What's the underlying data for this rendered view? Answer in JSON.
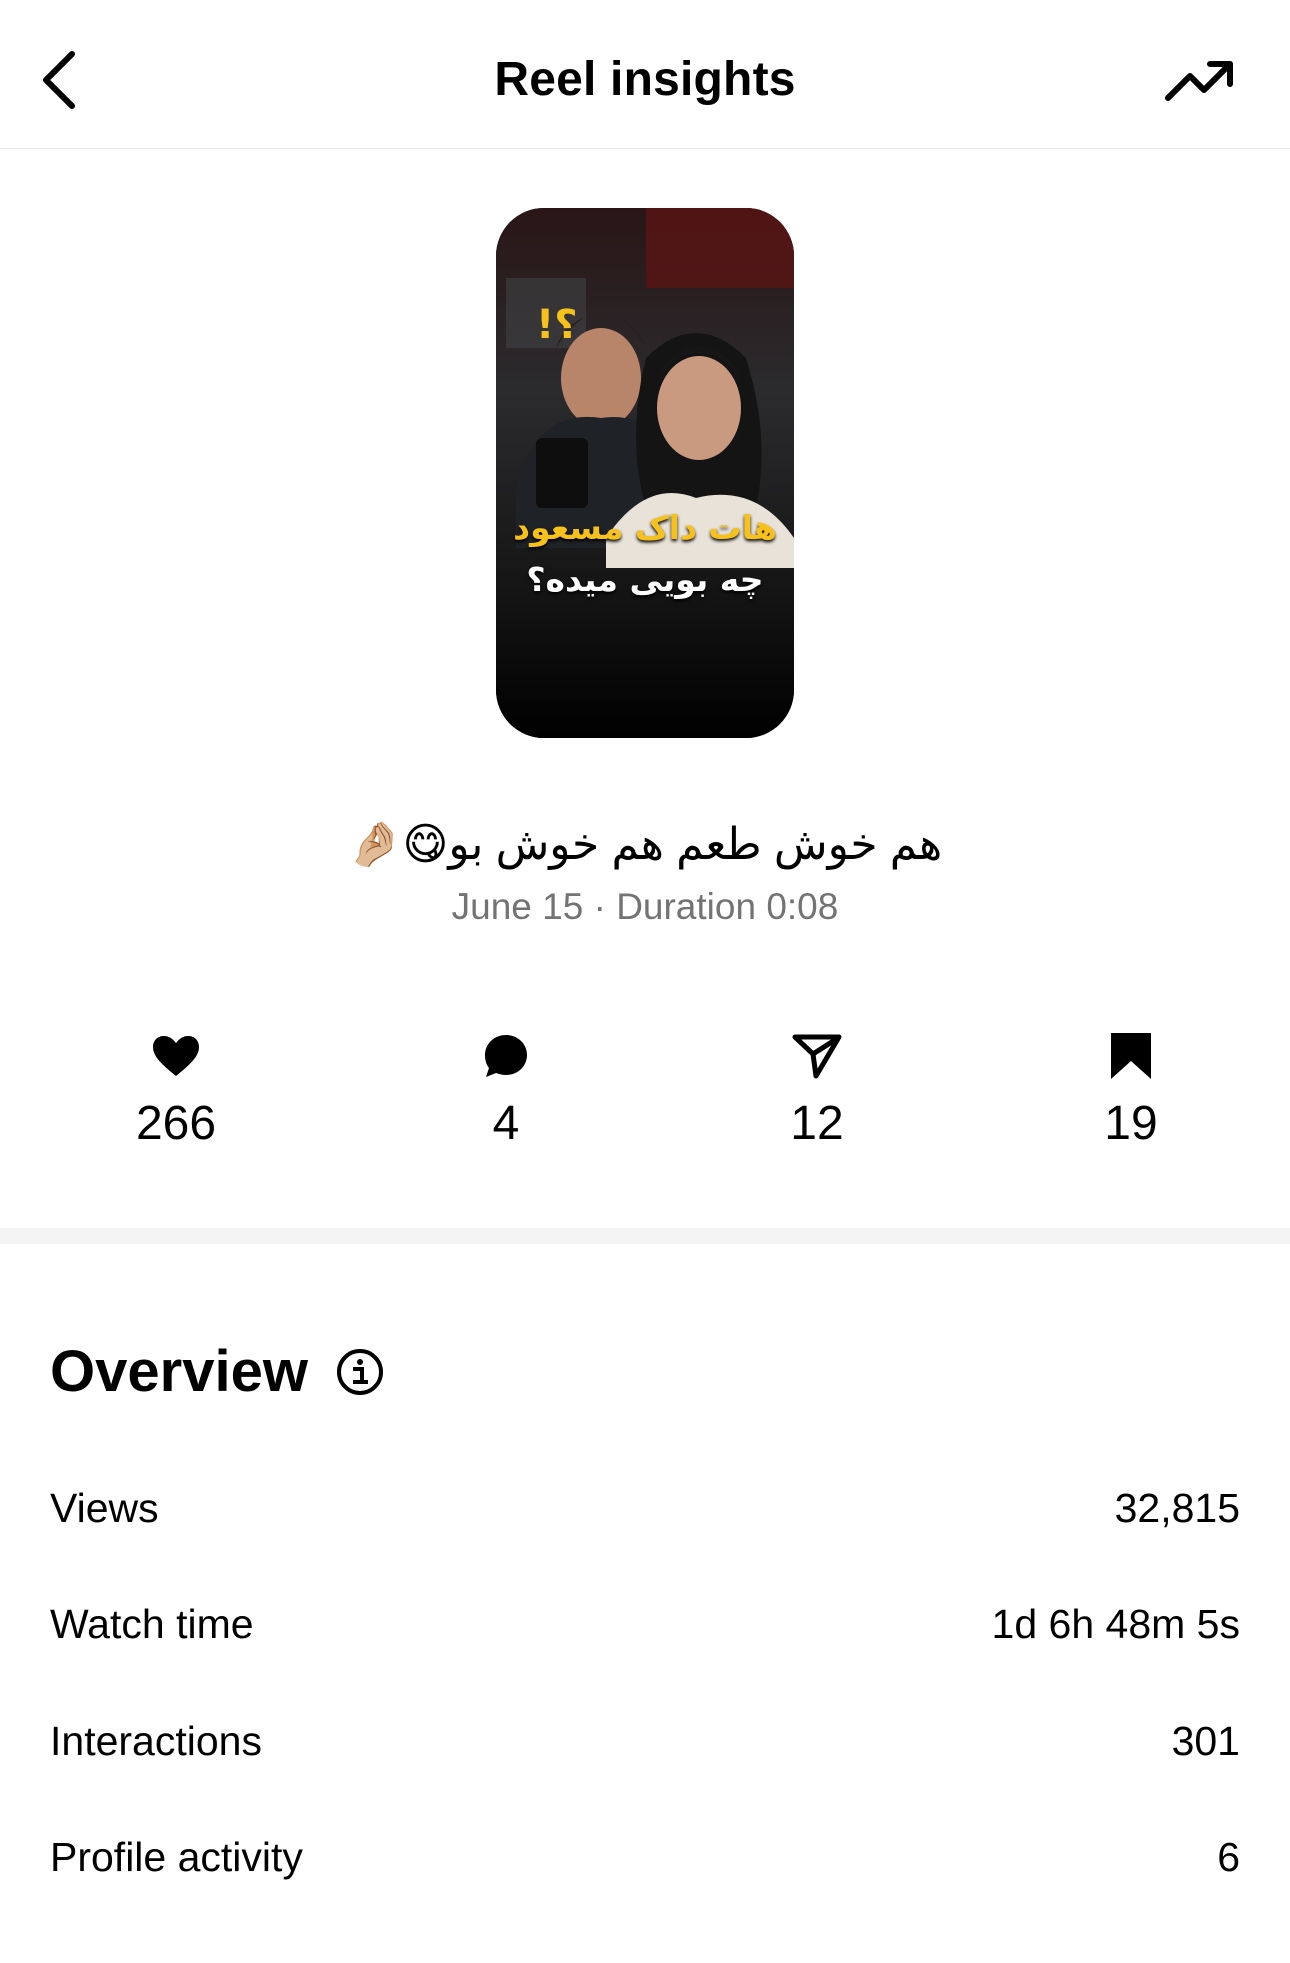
{
  "header": {
    "title": "Reel insights",
    "back_icon": "chevron-left-icon",
    "trend_icon": "trending-up-icon"
  },
  "reel": {
    "thumbnail_text_line1": "هات داک مسعود",
    "thumbnail_text_line2": "چه بویی میده؟",
    "thumbnail_text_line1_color": "#f6c11a",
    "caption": "هم خوش طعم هم خوش بو😋🤌🏼",
    "meta": "June 15 · Duration 0:08"
  },
  "stats": {
    "likes": "266",
    "comments": "4",
    "shares": "12",
    "saves": "19"
  },
  "overview": {
    "title": "Overview",
    "rows": [
      {
        "label": "Views",
        "value": "32,815"
      },
      {
        "label": "Watch time",
        "value": "1d 6h 48m 5s"
      },
      {
        "label": "Interactions",
        "value": "301"
      },
      {
        "label": "Profile activity",
        "value": "6"
      }
    ]
  },
  "colors": {
    "background": "#ffffff",
    "text": "#000000",
    "secondary_text": "#737373",
    "divider": "#f4f4f4"
  }
}
